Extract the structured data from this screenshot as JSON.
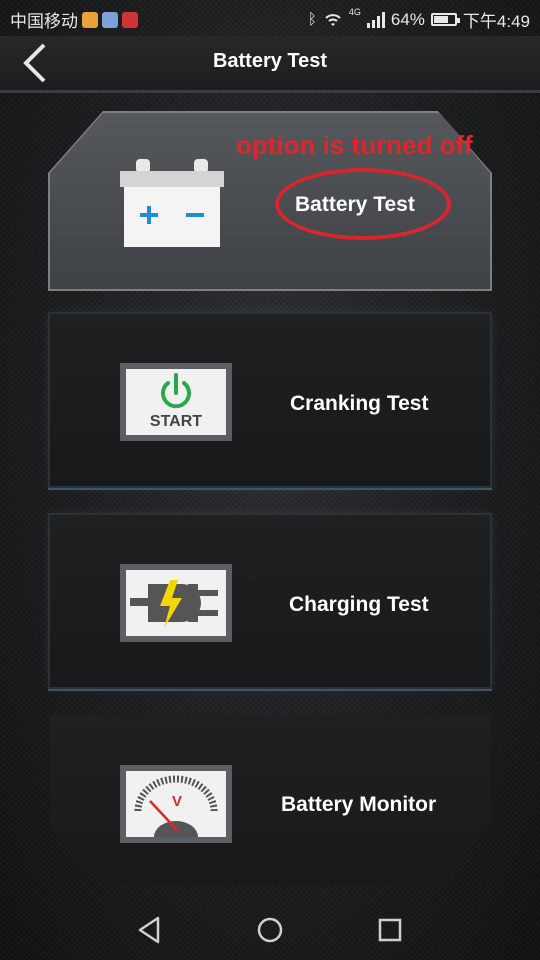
{
  "status_bar": {
    "carrier": "中国移动",
    "battery_percent": "64%",
    "time": "下午4:49",
    "network": "4G",
    "battery_level": 0.64
  },
  "header": {
    "title": "Battery Test"
  },
  "cards": [
    {
      "label": "Battery Test",
      "icon": "car-battery-icon"
    },
    {
      "label": "Cranking Test",
      "icon": "power-start-icon",
      "icon_text": "START"
    },
    {
      "label": "Charging Test",
      "icon": "charging-plug-icon"
    },
    {
      "label": "Battery Monitor",
      "icon": "voltmeter-icon",
      "icon_text": "V"
    }
  ],
  "annotation": {
    "text": "option is turned off",
    "color": "#e0262b"
  },
  "colors": {
    "accent_green": "#2aa84a",
    "accent_yellow": "#f2d600",
    "plus_minus_blue": "#1f8fd1"
  }
}
